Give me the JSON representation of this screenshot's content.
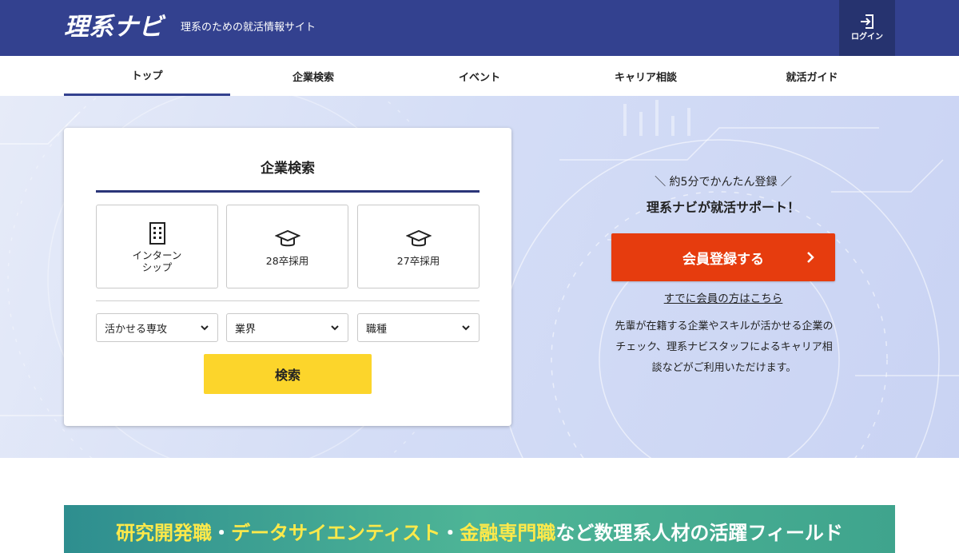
{
  "header": {
    "logo": "理系ナビ",
    "tagline": "理系のための就活情報サイト",
    "login_label": "ログイン"
  },
  "nav": {
    "items": [
      {
        "label": "トップ",
        "active": true
      },
      {
        "label": "企業検索",
        "active": false
      },
      {
        "label": "イベント",
        "active": false
      },
      {
        "label": "キャリア相談",
        "active": false
      },
      {
        "label": "就活ガイド",
        "active": false
      }
    ]
  },
  "search": {
    "title": "企業検索",
    "tiles": [
      {
        "label": "インターン\nシップ",
        "icon": "building-icon"
      },
      {
        "label": "28卒採用",
        "icon": "graduation-cap-icon"
      },
      {
        "label": "27卒採用",
        "icon": "graduation-cap-icon"
      }
    ],
    "selects": [
      {
        "value": "活かせる専攻"
      },
      {
        "value": "業界"
      },
      {
        "value": "職種"
      }
    ],
    "button_label": "検索"
  },
  "cta": {
    "sub": "＼ 約5分でかんたん登録 ／",
    "main": "理系ナビが就活サポート！",
    "register_label": "会員登録する",
    "member_link": "すでに会員の方はこちら",
    "description_lines": [
      "先輩が在籍する企業やスキルが活かせる企業の",
      "チェック、理系ナビスタッフによるキャリア相",
      "談などがご利用いただけます。"
    ]
  },
  "banner": {
    "highlight_1": "研究開発職",
    "sep_1": "・",
    "highlight_2": "データサイエンティスト",
    "sep_2": "・",
    "highlight_3": "金融専門職",
    "rest": "など数理系人材の活躍フィールド"
  },
  "colors": {
    "header_bg": "#33418f",
    "register_btn": "#e63c0e",
    "search_btn": "#fcd52b",
    "banner_highlight": "#fde94a"
  }
}
